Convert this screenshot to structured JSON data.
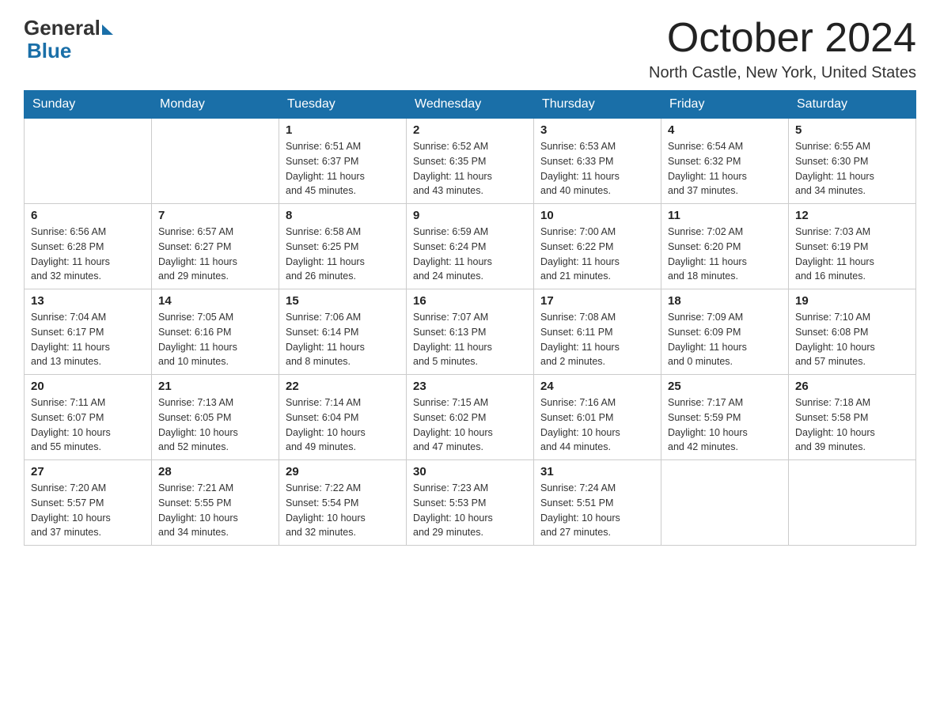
{
  "header": {
    "logo_general": "General",
    "logo_blue": "Blue",
    "month_title": "October 2024",
    "location": "North Castle, New York, United States"
  },
  "days_of_week": [
    "Sunday",
    "Monday",
    "Tuesday",
    "Wednesday",
    "Thursday",
    "Friday",
    "Saturday"
  ],
  "weeks": [
    [
      {
        "day": "",
        "info": ""
      },
      {
        "day": "",
        "info": ""
      },
      {
        "day": "1",
        "info": "Sunrise: 6:51 AM\nSunset: 6:37 PM\nDaylight: 11 hours\nand 45 minutes."
      },
      {
        "day": "2",
        "info": "Sunrise: 6:52 AM\nSunset: 6:35 PM\nDaylight: 11 hours\nand 43 minutes."
      },
      {
        "day": "3",
        "info": "Sunrise: 6:53 AM\nSunset: 6:33 PM\nDaylight: 11 hours\nand 40 minutes."
      },
      {
        "day": "4",
        "info": "Sunrise: 6:54 AM\nSunset: 6:32 PM\nDaylight: 11 hours\nand 37 minutes."
      },
      {
        "day": "5",
        "info": "Sunrise: 6:55 AM\nSunset: 6:30 PM\nDaylight: 11 hours\nand 34 minutes."
      }
    ],
    [
      {
        "day": "6",
        "info": "Sunrise: 6:56 AM\nSunset: 6:28 PM\nDaylight: 11 hours\nand 32 minutes."
      },
      {
        "day": "7",
        "info": "Sunrise: 6:57 AM\nSunset: 6:27 PM\nDaylight: 11 hours\nand 29 minutes."
      },
      {
        "day": "8",
        "info": "Sunrise: 6:58 AM\nSunset: 6:25 PM\nDaylight: 11 hours\nand 26 minutes."
      },
      {
        "day": "9",
        "info": "Sunrise: 6:59 AM\nSunset: 6:24 PM\nDaylight: 11 hours\nand 24 minutes."
      },
      {
        "day": "10",
        "info": "Sunrise: 7:00 AM\nSunset: 6:22 PM\nDaylight: 11 hours\nand 21 minutes."
      },
      {
        "day": "11",
        "info": "Sunrise: 7:02 AM\nSunset: 6:20 PM\nDaylight: 11 hours\nand 18 minutes."
      },
      {
        "day": "12",
        "info": "Sunrise: 7:03 AM\nSunset: 6:19 PM\nDaylight: 11 hours\nand 16 minutes."
      }
    ],
    [
      {
        "day": "13",
        "info": "Sunrise: 7:04 AM\nSunset: 6:17 PM\nDaylight: 11 hours\nand 13 minutes."
      },
      {
        "day": "14",
        "info": "Sunrise: 7:05 AM\nSunset: 6:16 PM\nDaylight: 11 hours\nand 10 minutes."
      },
      {
        "day": "15",
        "info": "Sunrise: 7:06 AM\nSunset: 6:14 PM\nDaylight: 11 hours\nand 8 minutes."
      },
      {
        "day": "16",
        "info": "Sunrise: 7:07 AM\nSunset: 6:13 PM\nDaylight: 11 hours\nand 5 minutes."
      },
      {
        "day": "17",
        "info": "Sunrise: 7:08 AM\nSunset: 6:11 PM\nDaylight: 11 hours\nand 2 minutes."
      },
      {
        "day": "18",
        "info": "Sunrise: 7:09 AM\nSunset: 6:09 PM\nDaylight: 11 hours\nand 0 minutes."
      },
      {
        "day": "19",
        "info": "Sunrise: 7:10 AM\nSunset: 6:08 PM\nDaylight: 10 hours\nand 57 minutes."
      }
    ],
    [
      {
        "day": "20",
        "info": "Sunrise: 7:11 AM\nSunset: 6:07 PM\nDaylight: 10 hours\nand 55 minutes."
      },
      {
        "day": "21",
        "info": "Sunrise: 7:13 AM\nSunset: 6:05 PM\nDaylight: 10 hours\nand 52 minutes."
      },
      {
        "day": "22",
        "info": "Sunrise: 7:14 AM\nSunset: 6:04 PM\nDaylight: 10 hours\nand 49 minutes."
      },
      {
        "day": "23",
        "info": "Sunrise: 7:15 AM\nSunset: 6:02 PM\nDaylight: 10 hours\nand 47 minutes."
      },
      {
        "day": "24",
        "info": "Sunrise: 7:16 AM\nSunset: 6:01 PM\nDaylight: 10 hours\nand 44 minutes."
      },
      {
        "day": "25",
        "info": "Sunrise: 7:17 AM\nSunset: 5:59 PM\nDaylight: 10 hours\nand 42 minutes."
      },
      {
        "day": "26",
        "info": "Sunrise: 7:18 AM\nSunset: 5:58 PM\nDaylight: 10 hours\nand 39 minutes."
      }
    ],
    [
      {
        "day": "27",
        "info": "Sunrise: 7:20 AM\nSunset: 5:57 PM\nDaylight: 10 hours\nand 37 minutes."
      },
      {
        "day": "28",
        "info": "Sunrise: 7:21 AM\nSunset: 5:55 PM\nDaylight: 10 hours\nand 34 minutes."
      },
      {
        "day": "29",
        "info": "Sunrise: 7:22 AM\nSunset: 5:54 PM\nDaylight: 10 hours\nand 32 minutes."
      },
      {
        "day": "30",
        "info": "Sunrise: 7:23 AM\nSunset: 5:53 PM\nDaylight: 10 hours\nand 29 minutes."
      },
      {
        "day": "31",
        "info": "Sunrise: 7:24 AM\nSunset: 5:51 PM\nDaylight: 10 hours\nand 27 minutes."
      },
      {
        "day": "",
        "info": ""
      },
      {
        "day": "",
        "info": ""
      }
    ]
  ]
}
